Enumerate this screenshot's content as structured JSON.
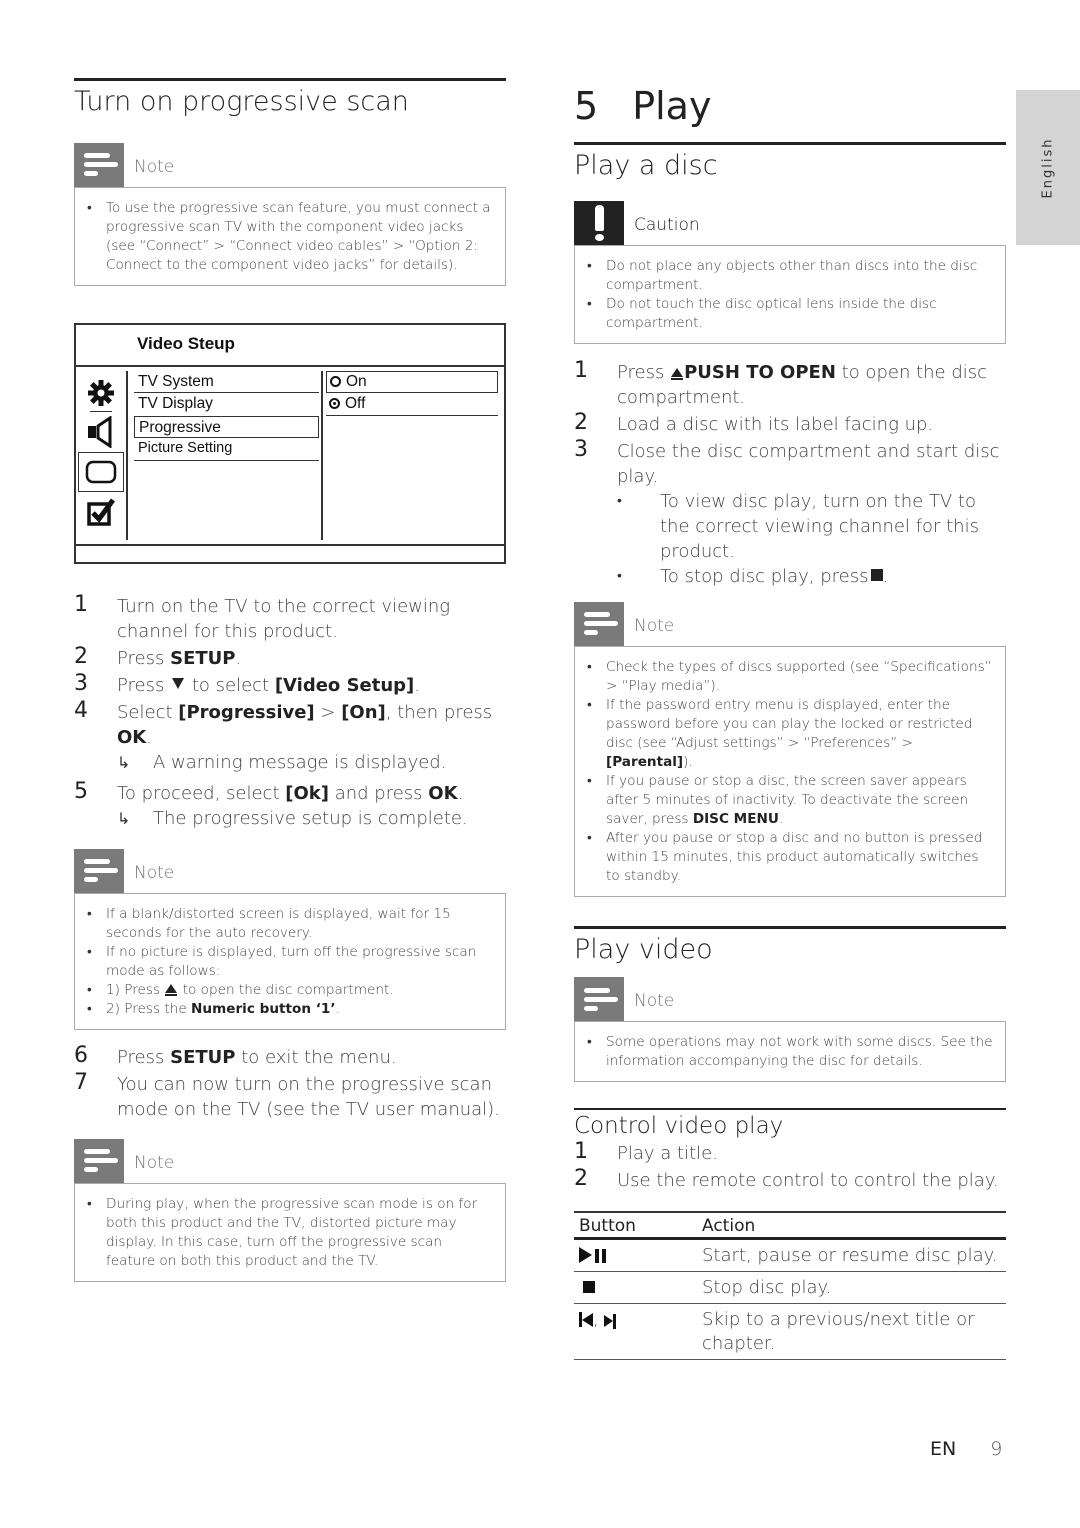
{
  "language_tab": "English",
  "left": {
    "title": "Turn on progressive scan",
    "note1": {
      "label": "Note",
      "items": [
        "To use the progressive scan feature, you must connect a progressive scan TV with the component video jacks (see “Connect” > “Connect video cables” > “Option 2: Connect to the component video jacks” for details)."
      ]
    },
    "menu": {
      "title": "Video Steup",
      "icons": [
        "gear-icon",
        "speaker-icon",
        "screen-icon",
        "checkbox-icon"
      ],
      "items": [
        "TV System",
        "TV Display",
        "Progressive",
        "Picture Setting"
      ],
      "selected_item": "Progressive",
      "options": [
        "On",
        "Off"
      ],
      "selected_option": "Off",
      "highlighted_option": "On"
    },
    "steps": [
      {
        "num": "1",
        "text": "Turn on the TV to the correct viewing channel for this product."
      },
      {
        "num": "2",
        "pre": "Press ",
        "bold": "SETUP",
        "post": "."
      },
      {
        "num": "3",
        "pre": "Press ",
        "post_glyph": " to select ",
        "bold": "[Video Setup]",
        "post": "."
      },
      {
        "num": "4",
        "pre": "Select ",
        "bold": "[Progressive]",
        "mid": " > ",
        "bold2": "[On]",
        "mid2": ", then press ",
        "bold3": "OK",
        "post": ".",
        "result": "A warning message is displayed."
      },
      {
        "num": "5",
        "pre": "To proceed, select ",
        "bold": "[Ok]",
        "mid": " and press ",
        "bold2": "OK",
        "post": ".",
        "result": "The progressive setup is complete."
      }
    ],
    "note2": {
      "label": "Note",
      "items": [
        "If a blank/distorted screen is displayed, wait for 15 seconds for the auto recovery.",
        "If no picture is displayed, turn off the progressive scan mode as follows:",
        "1) Press",
        "to open the disc compartment.",
        "2) Press the ",
        "Numeric button ‘1’",
        "."
      ]
    },
    "steps2": [
      {
        "num": "6",
        "pre": "Press ",
        "bold": "SETUP",
        "post": " to exit the menu."
      },
      {
        "num": "7",
        "text": "You can now turn on the progressive scan mode on the TV (see the TV user manual)."
      }
    ],
    "note3": {
      "label": "Note",
      "items": [
        "During play, when the progressive scan mode is on for both this product and the TV, distorted picture may display. In this case, turn off the progressive scan feature on both this product and the TV."
      ]
    }
  },
  "right": {
    "chapter_num": "5",
    "chapter_title": "Play",
    "section1": "Play a disc",
    "caution": {
      "label": "Caution",
      "items": [
        "Do not place any objects other than discs into the disc compartment.",
        "Do not touch the disc optical lens inside the disc compartment."
      ]
    },
    "steps": [
      {
        "num": "1",
        "pre": "Press ",
        "bold": "PUSH TO OPEN",
        "post": " to open the disc compartment."
      },
      {
        "num": "2",
        "text": "Load a disc with its label facing up."
      },
      {
        "num": "3",
        "text": "Close the disc compartment and start disc play.",
        "bullets": [
          "To view disc play, turn on the TV to the correct viewing channel for this product.",
          "To stop disc play, press"
        ]
      }
    ],
    "note1": {
      "label": "Note",
      "items": [
        "Check the types of discs supported (see “Specifications” > “Play media”).",
        "If the password entry menu is displayed, enter the password before you can play the locked or restricted disc (see “Adjust settings” > “Preferences” > ",
        "[Parental]",
        ").",
        "If you pause or stop a disc, the screen saver appears after 5 minutes of inactivity. To deactivate the screen saver, press ",
        "DISC MENU",
        ".",
        "After you pause or stop a disc and no button is pressed within 15 minutes, this product automatically switches to standby."
      ]
    },
    "section2": "Play video",
    "note2": {
      "label": "Note",
      "items": [
        "Some operations may not work with some discs. See the information accompanying the disc for details."
      ]
    },
    "subsection": "Control video play",
    "steps2": [
      {
        "num": "1",
        "text": "Play a title."
      },
      {
        "num": "2",
        "text": "Use the remote control to control the play."
      }
    ],
    "table": {
      "headers": [
        "Button",
        "Action"
      ],
      "rows": [
        {
          "button": "play-pause",
          "action": "Start, pause or resume disc play."
        },
        {
          "button": "stop",
          "action": "Stop disc play."
        },
        {
          "button": "prev-next",
          "sep": ",",
          "action": "Skip to a previous/next title or chapter."
        }
      ]
    }
  },
  "footer": {
    "lang": "EN",
    "page": "9"
  }
}
